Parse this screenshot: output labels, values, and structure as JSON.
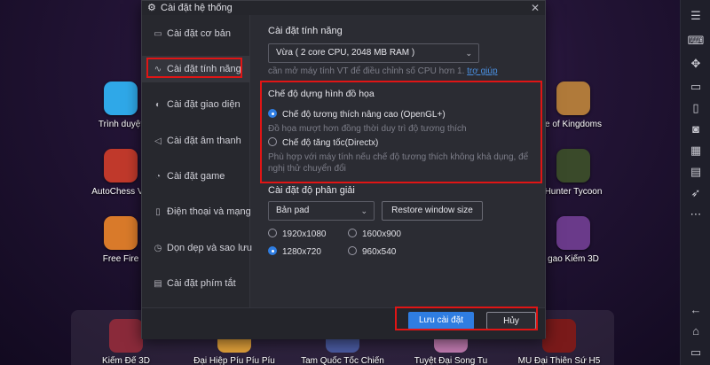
{
  "desktop": {
    "apps": [
      {
        "label": "Trình duyệt",
        "color": "#2fa8e8",
        "icon": "browser-app-icon"
      },
      {
        "label": "AutoChess VN",
        "color": "#c0392b",
        "icon": "autochess-app-icon"
      },
      {
        "label": "Free Fire",
        "color": "#d97a2a",
        "icon": "free-fire-app-icon"
      },
      {
        "label": "e of Kingdoms",
        "color": "#b07a3a",
        "icon": "kingdoms-app-icon"
      },
      {
        "label": "Hunter Tycoon",
        "color": "#3a4a2a",
        "icon": "hunter-tycoon-app-icon"
      },
      {
        "label": "gao Kiếm 3D",
        "color": "#6a3a8a",
        "icon": "kiem-3d-app-icon"
      }
    ],
    "dock": [
      {
        "label": "Kiếm Đế 3D",
        "color": "#8a2a3a"
      },
      {
        "label": "Đại Hiệp Píu Píu Píu",
        "color": "#e0a03a"
      },
      {
        "label": "Tam Quốc Tốc Chiến",
        "color": "#4a5aa0"
      },
      {
        "label": "Tuyệt Đại Song Tu",
        "color": "#c07ab0"
      },
      {
        "label": "MU Đại Thiên Sứ H5",
        "color": "#7a1a1a"
      }
    ]
  },
  "toolbar": {
    "icons": [
      "menu-icon",
      "keyboard-icon",
      "gamepad-icon",
      "screen-icon",
      "phone-icon",
      "camera-icon",
      "apk-icon",
      "folder-icon",
      "rocket-icon",
      "more-icon",
      "back-icon",
      "home-icon",
      "recent-icon"
    ]
  },
  "dialog": {
    "title": "Cài đặt hệ thống",
    "close_glyph": "✕",
    "sidebar": [
      {
        "label": "Cài đặt cơ bản",
        "glyph": "▭"
      },
      {
        "label": "Cài đặt tính năng",
        "glyph": "∿"
      },
      {
        "label": "Cài đặt giao diện",
        "glyph": "◐"
      },
      {
        "label": "Cài đặt âm thanh",
        "glyph": "◁"
      },
      {
        "label": "Cài đặt game",
        "glyph": "◔"
      },
      {
        "label": "Điện thoại và mạng",
        "glyph": "▯"
      },
      {
        "label": "Dọn dẹp và sao lưu",
        "glyph": "◷"
      },
      {
        "label": "Cài đặt phím tắt",
        "glyph": "▤"
      }
    ],
    "features": {
      "title": "Cài đặt tính năng",
      "performance_value": "Vừa ( 2 core CPU, 2048 MB RAM )",
      "cpu_hint": "cần mở máy tính VT để điều chỉnh số CPU hơn 1.",
      "help_link": "trợ giúp"
    },
    "graphics": {
      "title": "Chế độ dựng hình đồ họa",
      "option1_label": "Chế độ tương thích nâng cao (OpenGL+)",
      "option1_hint": "Đồ họa mượt hơn đồng thời duy trì độ tương thích",
      "option2_label": "Chế độ tăng tốc(Directx)",
      "option2_hint_line1": "Phù hợp với máy tính nếu chế độ tương thích không khả dụng, để",
      "option2_hint_line2": "nghị thử chuyển đổi"
    },
    "resolution": {
      "title": "Cài đặt độ phân giải",
      "mode_value": "Bản pad",
      "restore_label": "Restore window size",
      "options": [
        "1920x1080",
        "1600x900",
        "1280x720",
        "960x540"
      ],
      "selected": "1280x720"
    },
    "footer": {
      "save_label": "Lưu cài đặt",
      "cancel_label": "Hủy"
    }
  },
  "colors": {
    "accent": "#2f7de1",
    "highlight_box": "#e01515"
  }
}
